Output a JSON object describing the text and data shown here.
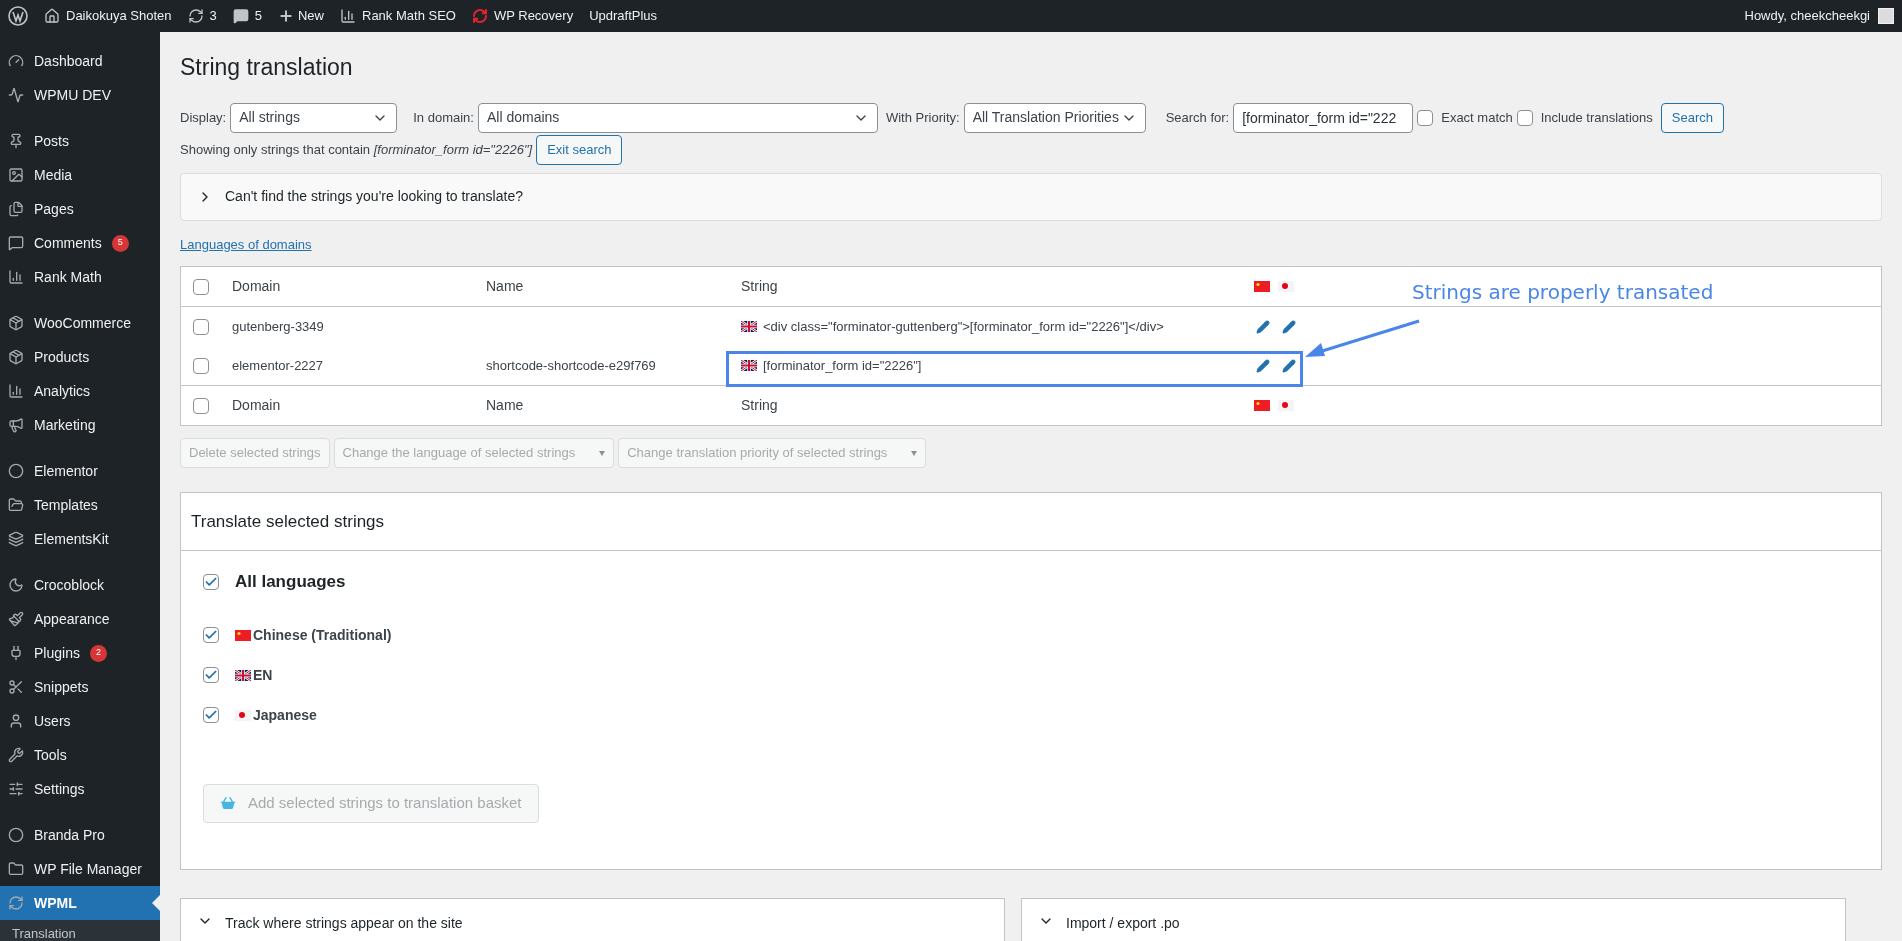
{
  "admin_bar": {
    "site": "Daikokuya Shoten",
    "updates": "3",
    "comments": "5",
    "new": "New",
    "items": [
      "Rank Math SEO",
      "WP Recovery",
      "UpdraftPlus"
    ],
    "greeting": "Howdy, cheekcheekgi"
  },
  "sidebar": {
    "groups": [
      {
        "items": [
          {
            "label": "Dashboard",
            "selected": false
          },
          {
            "label": "WPMU DEV",
            "selected": false
          }
        ]
      },
      {
        "items": [
          {
            "label": "Posts",
            "selected": false
          },
          {
            "label": "Media",
            "selected": false
          },
          {
            "label": "Pages",
            "selected": false
          },
          {
            "label": "Comments",
            "selected": false,
            "badge": "5"
          },
          {
            "label": "Rank Math",
            "selected": false
          }
        ]
      },
      {
        "items": [
          {
            "label": "WooCommerce",
            "selected": false
          },
          {
            "label": "Products",
            "selected": false
          },
          {
            "label": "Analytics",
            "selected": false
          },
          {
            "label": "Marketing",
            "selected": false
          }
        ]
      },
      {
        "items": [
          {
            "label": "Elementor",
            "selected": false
          },
          {
            "label": "Templates",
            "selected": false
          },
          {
            "label": "ElementsKit",
            "selected": false
          }
        ]
      },
      {
        "items": [
          {
            "label": "Crocoblock",
            "selected": false
          },
          {
            "label": "Appearance",
            "selected": false
          },
          {
            "label": "Plugins",
            "selected": false,
            "badge": "2"
          },
          {
            "label": "Snippets",
            "selected": false
          },
          {
            "label": "Users",
            "selected": false
          },
          {
            "label": "Tools",
            "selected": false
          },
          {
            "label": "Settings",
            "selected": false
          }
        ]
      },
      {
        "items": [
          {
            "label": "Branda Pro",
            "selected": false
          },
          {
            "label": "WP File Manager",
            "selected": false
          },
          {
            "label": "WPML",
            "selected": true
          }
        ]
      }
    ],
    "submenu": [
      "Translation"
    ]
  },
  "page": {
    "title": "String translation",
    "filters": {
      "display_label": "Display:",
      "display": "All strings",
      "domain_label": "In domain:",
      "domain": "All domains",
      "priority_label": "With Priority:",
      "priority": "All Translation Priorities",
      "search_label": "Search for:",
      "search": "[forminator_form id=\"222",
      "exact_match": {
        "label": "Exact match",
        "checked": false
      },
      "include_translations": {
        "label": "Include translations",
        "checked": false
      },
      "search_button": "Search"
    },
    "showing": {
      "text": "Showing only strings that contain",
      "term": "[forminator_form id=\"2226\"]",
      "exit_button": "Exit search"
    },
    "help_toggle": {
      "label": "Can't find the strings you're looking to translate?",
      "expanded": false
    },
    "languages_link": "Languages of domains",
    "table": {
      "select_all_checked": false,
      "columns": [
        "Domain",
        "Name",
        "String"
      ],
      "rows": [
        {
          "checked": false,
          "domain": "gutenberg-3349",
          "string": "<div class=\"forminator-guttenberg\">[forminator_form id=\"2226\"]</div>"
        },
        {
          "checked": false,
          "domain": "elementor-2227",
          "name": "shortcode-shortcode-e29f769",
          "string": "[forminator_form id=\"2226\"]",
          "highlighted": true
        }
      ],
      "footer_select_all_checked": false,
      "footer_columns": [
        "Domain",
        "Name",
        "String"
      ],
      "annotation": "Strings are properly transated"
    },
    "bulk_actions": [
      {
        "kind": "button",
        "label": "Delete selected strings",
        "disabled": true
      },
      {
        "kind": "select",
        "label": "Change the language of selected strings",
        "disabled": true
      },
      {
        "kind": "select",
        "label": "Change translation priority of selected strings",
        "disabled": true
      }
    ],
    "translate_panel": {
      "title": "Translate selected strings",
      "all_languages": {
        "label": "All languages",
        "checked": true
      },
      "languages": [
        {
          "label": "Chinese (Traditional)",
          "checked": true
        },
        {
          "label": "EN",
          "checked": true
        },
        {
          "label": "Japanese",
          "checked": true
        }
      ],
      "basket_button": {
        "label": "Add selected strings to translation basket",
        "disabled": true
      }
    },
    "bottom_panels": [
      {
        "label": "Track where strings appear on the site",
        "expanded": false
      },
      {
        "label": "Import / export .po",
        "expanded": false
      }
    ]
  }
}
